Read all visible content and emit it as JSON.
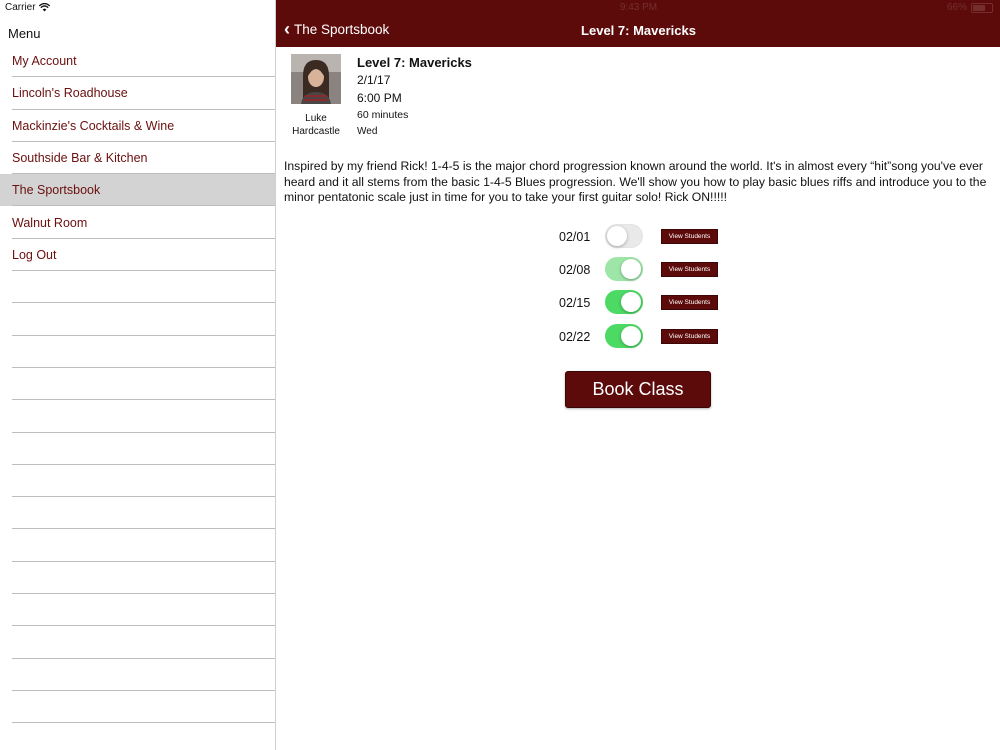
{
  "status": {
    "carrier": "Carrier",
    "time": "9:43 PM",
    "battery": "66%"
  },
  "sidebar": {
    "title": "Menu",
    "items": [
      {
        "label": "My Account"
      },
      {
        "label": "Lincoln's Roadhouse"
      },
      {
        "label": "Mackinzie's Cocktails & Wine"
      },
      {
        "label": "Southside Bar & Kitchen"
      },
      {
        "label": "The Sportsbook"
      },
      {
        "label": "Walnut Room"
      },
      {
        "label": "Log Out"
      }
    ],
    "active": "The Sportsbook"
  },
  "navbar": {
    "back_label": "The Sportsbook",
    "title": "Level 7: Mavericks"
  },
  "class": {
    "title": "Level 7: Mavericks",
    "date": "2/1/17",
    "time": "6:00 PM",
    "duration": "60 minutes",
    "day": "Wed",
    "instructor": "Luke Hardcastle",
    "description": "Inspired by my friend Rick!  1-4-5 is the major chord progression known around the world. It's in almost every “hit”song you've ever heard and it all stems from the basic 1-4-5 Blues progression. We'll show you how to play basic blues riffs and introduce you to the minor pentatonic scale just in time for you to take your first guitar solo! Rick ON!!!!!"
  },
  "sessions": [
    {
      "date": "02/01",
      "enabled": false,
      "view_label": "View Students"
    },
    {
      "date": "02/08",
      "enabled": true,
      "view_label": "View Students"
    },
    {
      "date": "02/15",
      "enabled": true,
      "view_label": "View Students"
    },
    {
      "date": "02/22",
      "enabled": true,
      "view_label": "View Students"
    }
  ],
  "book_label": "Book Class",
  "colors": {
    "brand": "#5c0a0a",
    "toggle_on": "#4cd964",
    "link": "#6b0f0f"
  }
}
